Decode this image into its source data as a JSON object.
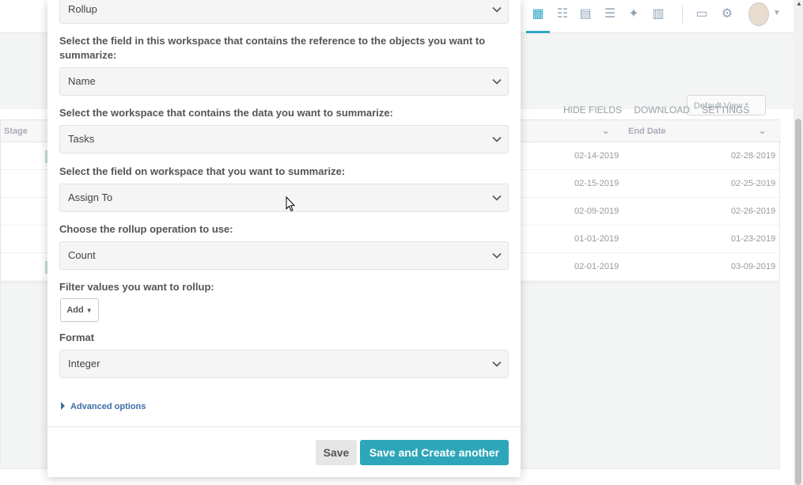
{
  "background": {
    "view_select": "Default View *",
    "tools": {
      "hide_fields": "HIDE FIELDS",
      "download": "DOWNLOAD",
      "settings": "SETTINGS"
    },
    "columns": {
      "stage": "Stage",
      "end_date": "End Date"
    },
    "rows": [
      {
        "start": "02-14-2019",
        "end": "02-28-2019"
      },
      {
        "start": "02-15-2019",
        "end": "02-25-2019"
      },
      {
        "start": "02-09-2019",
        "end": "02-26-2019"
      },
      {
        "start": "01-01-2019",
        "end": "01-23-2019"
      },
      {
        "start": "02-01-2019",
        "end": "03-09-2019"
      }
    ],
    "nav_icons": [
      "grid-icon",
      "hierarchy-icon",
      "calendar-icon",
      "gantt-icon",
      "network-icon",
      "chart-icon",
      "inbox-icon",
      "gear-icon",
      "avatar"
    ]
  },
  "modal": {
    "type_select": "Rollup",
    "ref_field_label": "Select the field in this workspace that contains the reference to the objects you want to summarize:",
    "ref_field_value": "Name",
    "workspace_label": "Select the workspace that contains the data you want to summarize:",
    "workspace_value": "Tasks",
    "summarize_field_label": "Select the field on workspace that you want to summarize:",
    "summarize_field_value": "Assign To",
    "operation_label": "Choose the rollup operation to use:",
    "operation_value": "Count",
    "filter_label": "Filter values you want to rollup:",
    "add_label": "Add",
    "format_label": "Format",
    "format_value": "Integer",
    "advanced_label": "Advanced options",
    "save_label": "Save",
    "save_another_label": "Save and Create another"
  },
  "colors": {
    "accent": "#2ea6b9",
    "link": "#3a6ea5"
  }
}
